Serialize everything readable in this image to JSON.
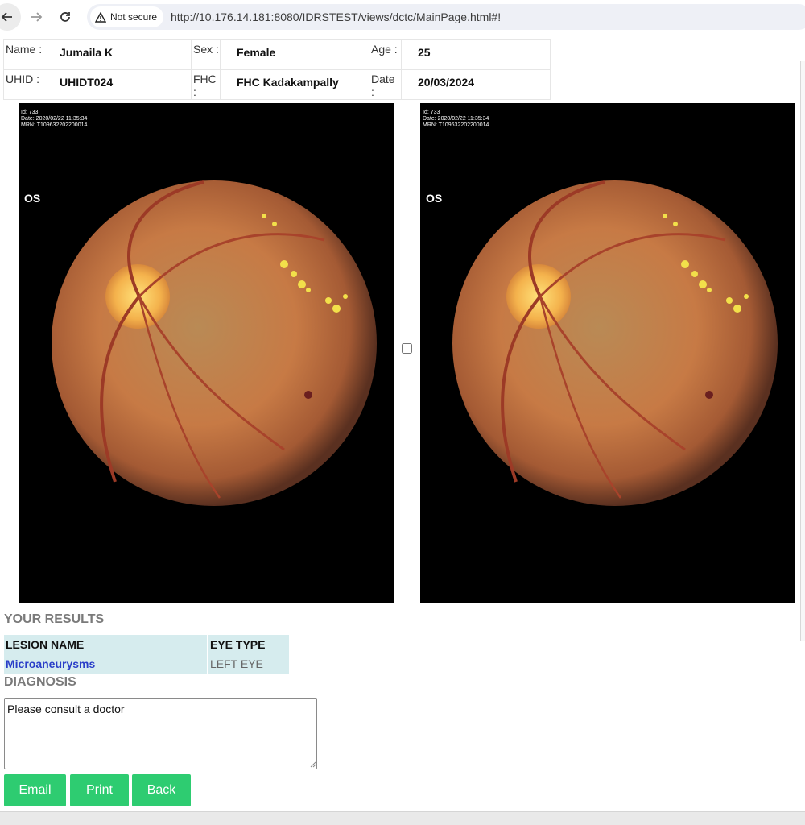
{
  "browser": {
    "security_label": "Not secure",
    "url": "http://10.176.14.181:8080/IDRSTEST/views/dctc/MainPage.html#!"
  },
  "patient": {
    "name_label": "Name :",
    "name": "Jumaila K",
    "sex_label": "Sex :",
    "sex": "Female",
    "age_label": "Age :",
    "age": "25",
    "uhid_label": "UHID :",
    "uhid": "UHIDT024",
    "fhc_label": "FHC :",
    "fhc": "FHC Kadakampally",
    "date_label": "Date :",
    "date": "20/03/2024"
  },
  "images": [
    {
      "id_line": "Id: 733",
      "date_line": "Date: 2020/02/22 11:35:34",
      "mrn_line": "MRN: T109632202200014",
      "eye": "OS"
    },
    {
      "id_line": "Id: 733",
      "date_line": "Date: 2020/02/22 11:35:34",
      "mrn_line": "MRN: T109632202200014",
      "eye": "OS"
    }
  ],
  "results": {
    "title": "YOUR RESULTS",
    "col_lesion": "LESION NAME",
    "col_eye": "EYE TYPE",
    "rows": [
      {
        "lesion": "Microaneurysms",
        "eye": "LEFT EYE"
      }
    ]
  },
  "diagnosis": {
    "title": "DIAGNOSIS",
    "value": "Please consult a doctor"
  },
  "buttons": {
    "email": "Email",
    "print": "Print",
    "back": "Back"
  },
  "colors": {
    "button": "#2ecc71",
    "result_cell": "#d6ecee",
    "lesion_text": "#2a3ec8"
  }
}
